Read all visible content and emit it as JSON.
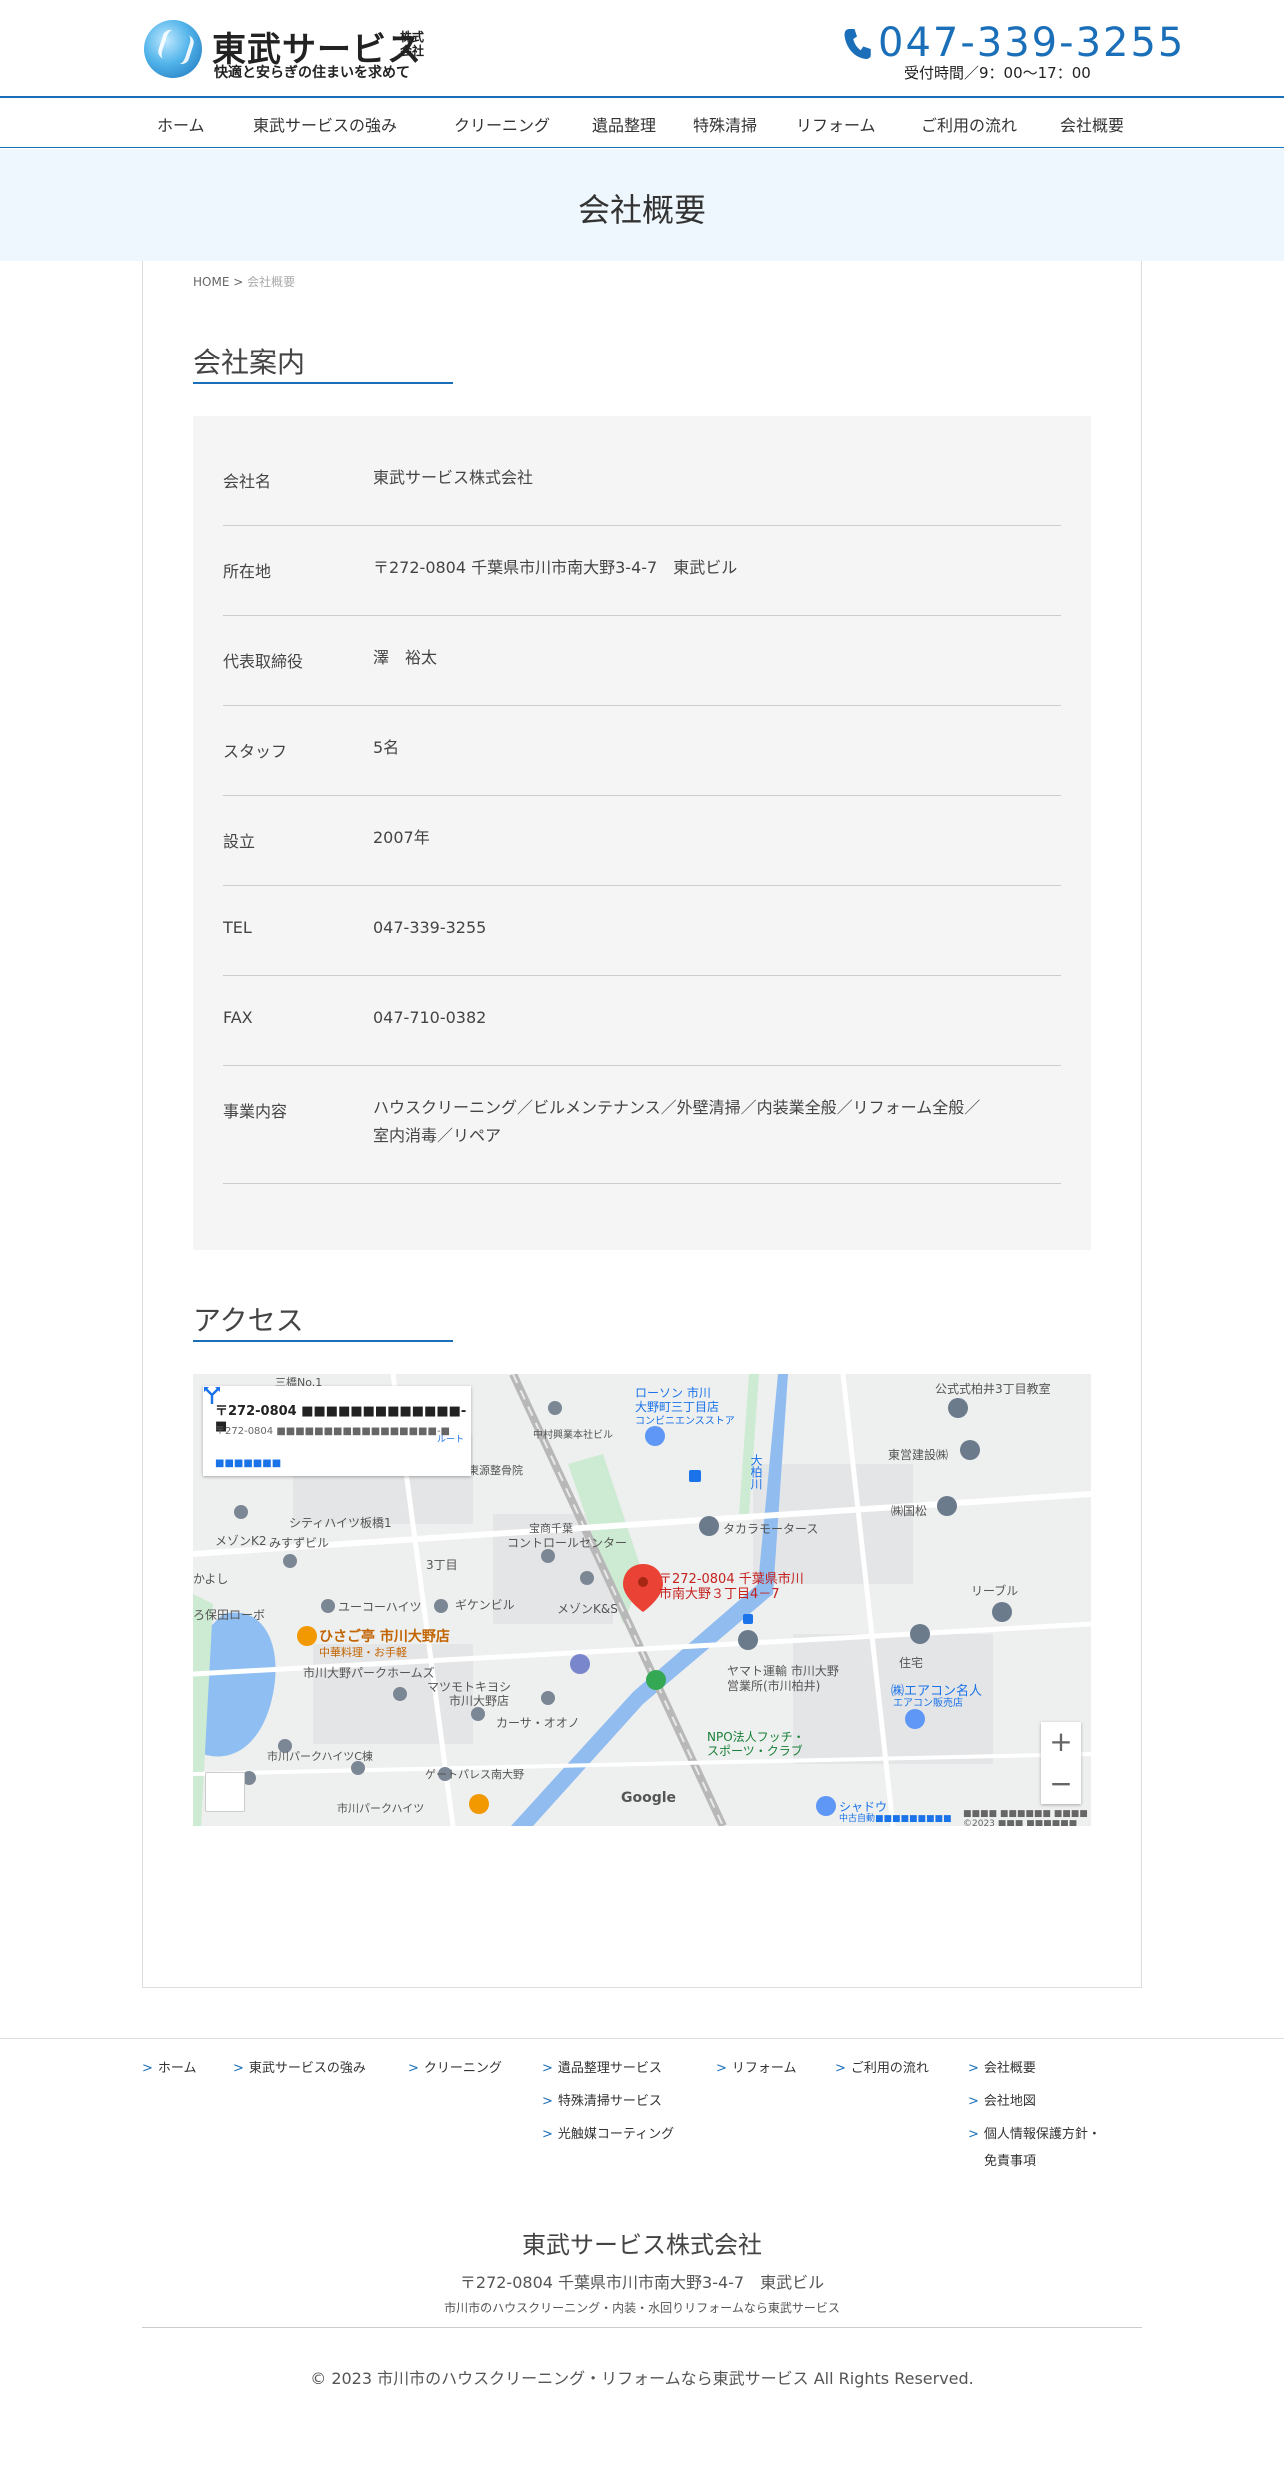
{
  "header": {
    "logo_name": "東武サービス",
    "logo_corp": "株式会社",
    "logo_tagline": "快適と安らぎの住まいを求めて",
    "phone": "047-339-3255",
    "hours": "受付時間／9：00～17：00"
  },
  "nav": [
    {
      "label": "ホーム"
    },
    {
      "label": "東武サービスの強み"
    },
    {
      "label": "クリーニング"
    },
    {
      "label": "遺品整理"
    },
    {
      "label": "特殊清掃"
    },
    {
      "label": "リフォーム"
    },
    {
      "label": "ご利用の流れ"
    },
    {
      "label": "会社概要"
    }
  ],
  "page_title": "会社概要",
  "breadcrumb": {
    "home": "HOME",
    "sep": ">",
    "current": "会社概要"
  },
  "company_section": {
    "heading": "会社案内",
    "rows": [
      {
        "label": "会社名",
        "value": "東武サービス株式会社"
      },
      {
        "label": "所在地",
        "value": "〒272-0804 千葉県市川市南大野3-4-7　東武ビル"
      },
      {
        "label": "代表取締役",
        "value": "澤　裕太"
      },
      {
        "label": "スタッフ",
        "value": "5名"
      },
      {
        "label": "設立",
        "value": "2007年"
      },
      {
        "label": "TEL",
        "value": "047-339-3255"
      },
      {
        "label": "FAX",
        "value": "047-710-0382"
      },
      {
        "label": "事業内容",
        "value": "ハウスクリーニング／ビルメンテナンス／外壁清掃／内装業全般／リフォーム全般／",
        "value2": "室内消毒／リペア"
      }
    ]
  },
  "access_section": {
    "heading": "アクセス",
    "map": {
      "card_title": "〒272-0804 ■■■■■■■■■■■■■-■",
      "card_address": "〒272-0804 ■■■■■■■■■■■■■■■■■-■",
      "card_link": "■■■■■■■",
      "directions_label": "ルート",
      "pin_label_1": "〒272-0804 千葉県市川",
      "pin_label_2": "市南大野３丁目4－7",
      "zoom_in": "+",
      "zoom_out": "−",
      "google": "Google",
      "copyright": "■■■■ ■■■■■■ ■■■■ ©2023 ■■■ ■■■■■■",
      "labels": {
        "lawson_1": "ローソン 市川",
        "lawson_2": "大野町三丁目店",
        "lawson_3": "コンビニエンスストア",
        "nakamura": "中村興業本社ビル",
        "koushiki": "公式式柏井3丁目教室",
        "touei": "東営建設㈱",
        "kunimatsu": "㈱国松",
        "takara": "タカラモータース",
        "riverside": "大柏川",
        "sanbashi": "三橋No.1",
        "kenen": "東源整骨院",
        "city_heights": "シティハイツ板橋1",
        "mezon_k2": "メゾンK2",
        "misuzu": "みすずビル",
        "houchi": "宝商千葉",
        "control": "コントロールセンター",
        "sanchome": "3丁目",
        "yuukou": "ユーコーハイツ",
        "giken": "ギケンビル",
        "mezon_ks": "メゾンK&S",
        "kayoshi": "かよし",
        "hosada": "ろ保田ローボ",
        "hisago_1": "ひさご亭 市川大野店",
        "hisago_2": "中華料理・お手軽",
        "park_homes": "市川大野パークホームズ",
        "matsumoto_1": "マツモトキヨシ",
        "matsumoto_2": "市川大野店",
        "casa": "カーサ・オオノ",
        "yamato_1": "ヤマト運輸 市川大野",
        "yamato_2": "営業所(市川柏井)",
        "npo_1": "NPO法人フッチ・",
        "npo_2": "スポーツ・クラブ",
        "park_heights_c": "市川パークハイツC棟",
        "gate_palace": "ゲートパレス南大野",
        "park_heights": "市川パークハイツ",
        "ribble": "リーブル",
        "jutaku": "住宅",
        "aircon_1": "㈱エアコン名人",
        "aircon_2": "エアコン販売店",
        "shadow_1": "シャドウ",
        "shadow_2": "中古自動■■■■■■■■■"
      }
    }
  },
  "footer": {
    "nav": [
      {
        "label": "ホーム"
      },
      {
        "label": "東武サービスの強み"
      },
      {
        "label": "クリーニング"
      },
      {
        "label": "遺品整理サービス"
      },
      {
        "label": "特殊清掃サービス"
      },
      {
        "label": "光触媒コーティング"
      },
      {
        "label": "リフォーム"
      },
      {
        "label": "ご利用の流れ"
      },
      {
        "label": "会社概要"
      },
      {
        "label": "会社地図"
      },
      {
        "label": "個人情報保護方針・",
        "label2": "免責事項"
      }
    ],
    "company": "東武サービス株式会社",
    "address": "〒272-0804 千葉県市川市南大野3-4-7　東武ビル",
    "tagline": "市川市のハウスクリーニング・内装・水回りリフォームなら東武サービス",
    "copyright": "©  2023 市川市のハウスクリーニング・リフォームなら東武サービス All Rights Reserved."
  },
  "colors": {
    "accent": "#1a6fb8",
    "title_band": "#eef7fd",
    "info_bg": "#f5f5f5"
  }
}
